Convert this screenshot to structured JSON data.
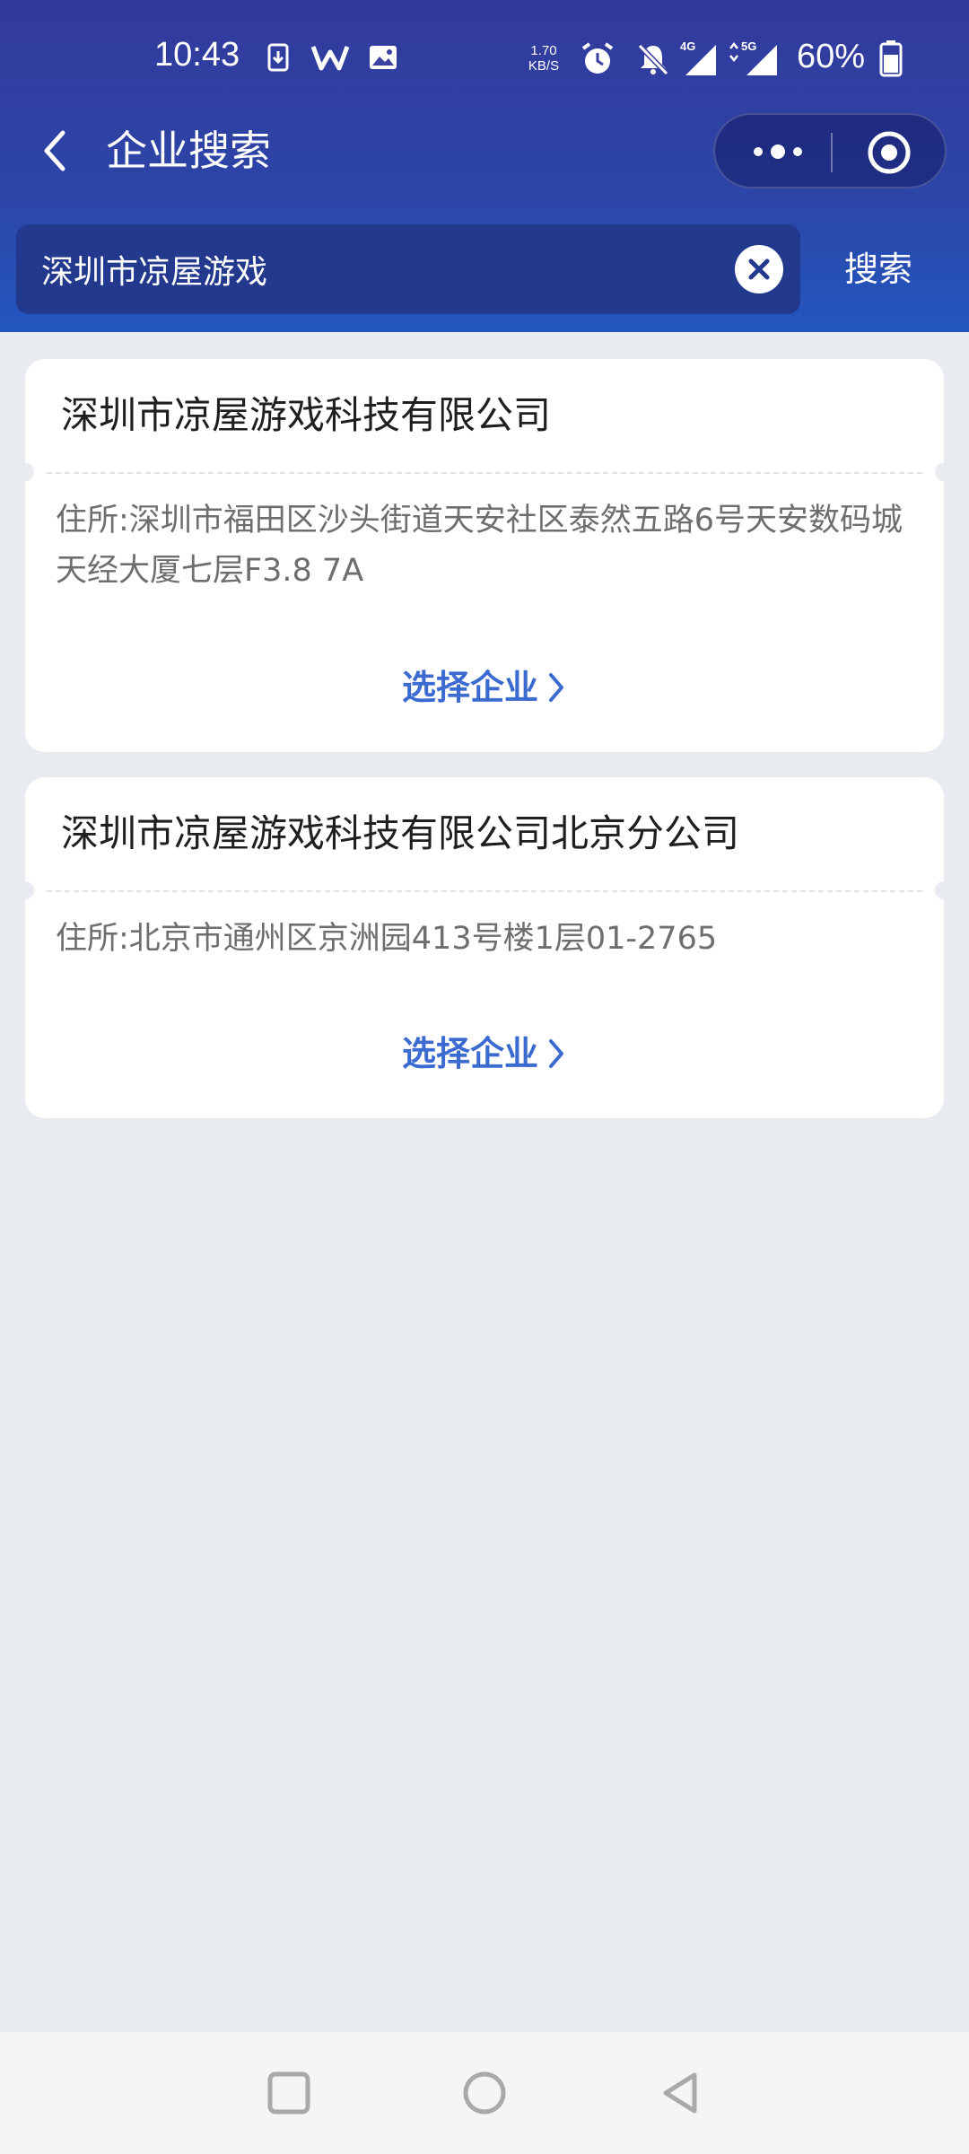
{
  "status_bar": {
    "time": "10:43",
    "net_speed_value": "1.70",
    "net_speed_unit": "KB/S",
    "network_1": "4G",
    "network_2": "5G",
    "battery_percent": "60%"
  },
  "nav": {
    "title": "企业搜索"
  },
  "search": {
    "query": "深圳市凉屋游戏",
    "button_label": "搜索"
  },
  "results": [
    {
      "name": "深圳市凉屋游戏科技有限公司",
      "address": "住所:深圳市福田区沙头街道天安社区泰然五路6号天安数码城天经大厦七层F3.8 7A",
      "action_label": "选择企业"
    },
    {
      "name": "深圳市凉屋游戏科技有限公司北京分公司",
      "address": "住所:北京市通州区京洲园413号楼1层01-2765",
      "action_label": "选择企业"
    }
  ],
  "colors": {
    "header_top": "#323a9c",
    "header_bottom": "#2357bf",
    "page_background": "#e8ebf0",
    "accent_link": "#3b6ad1"
  },
  "icons": {
    "back": "chevron-left-icon",
    "more": "more-dots-icon",
    "close_miniprogram": "target-circle-icon",
    "clear": "clear-x-icon",
    "select": "chevron-right-icon"
  }
}
